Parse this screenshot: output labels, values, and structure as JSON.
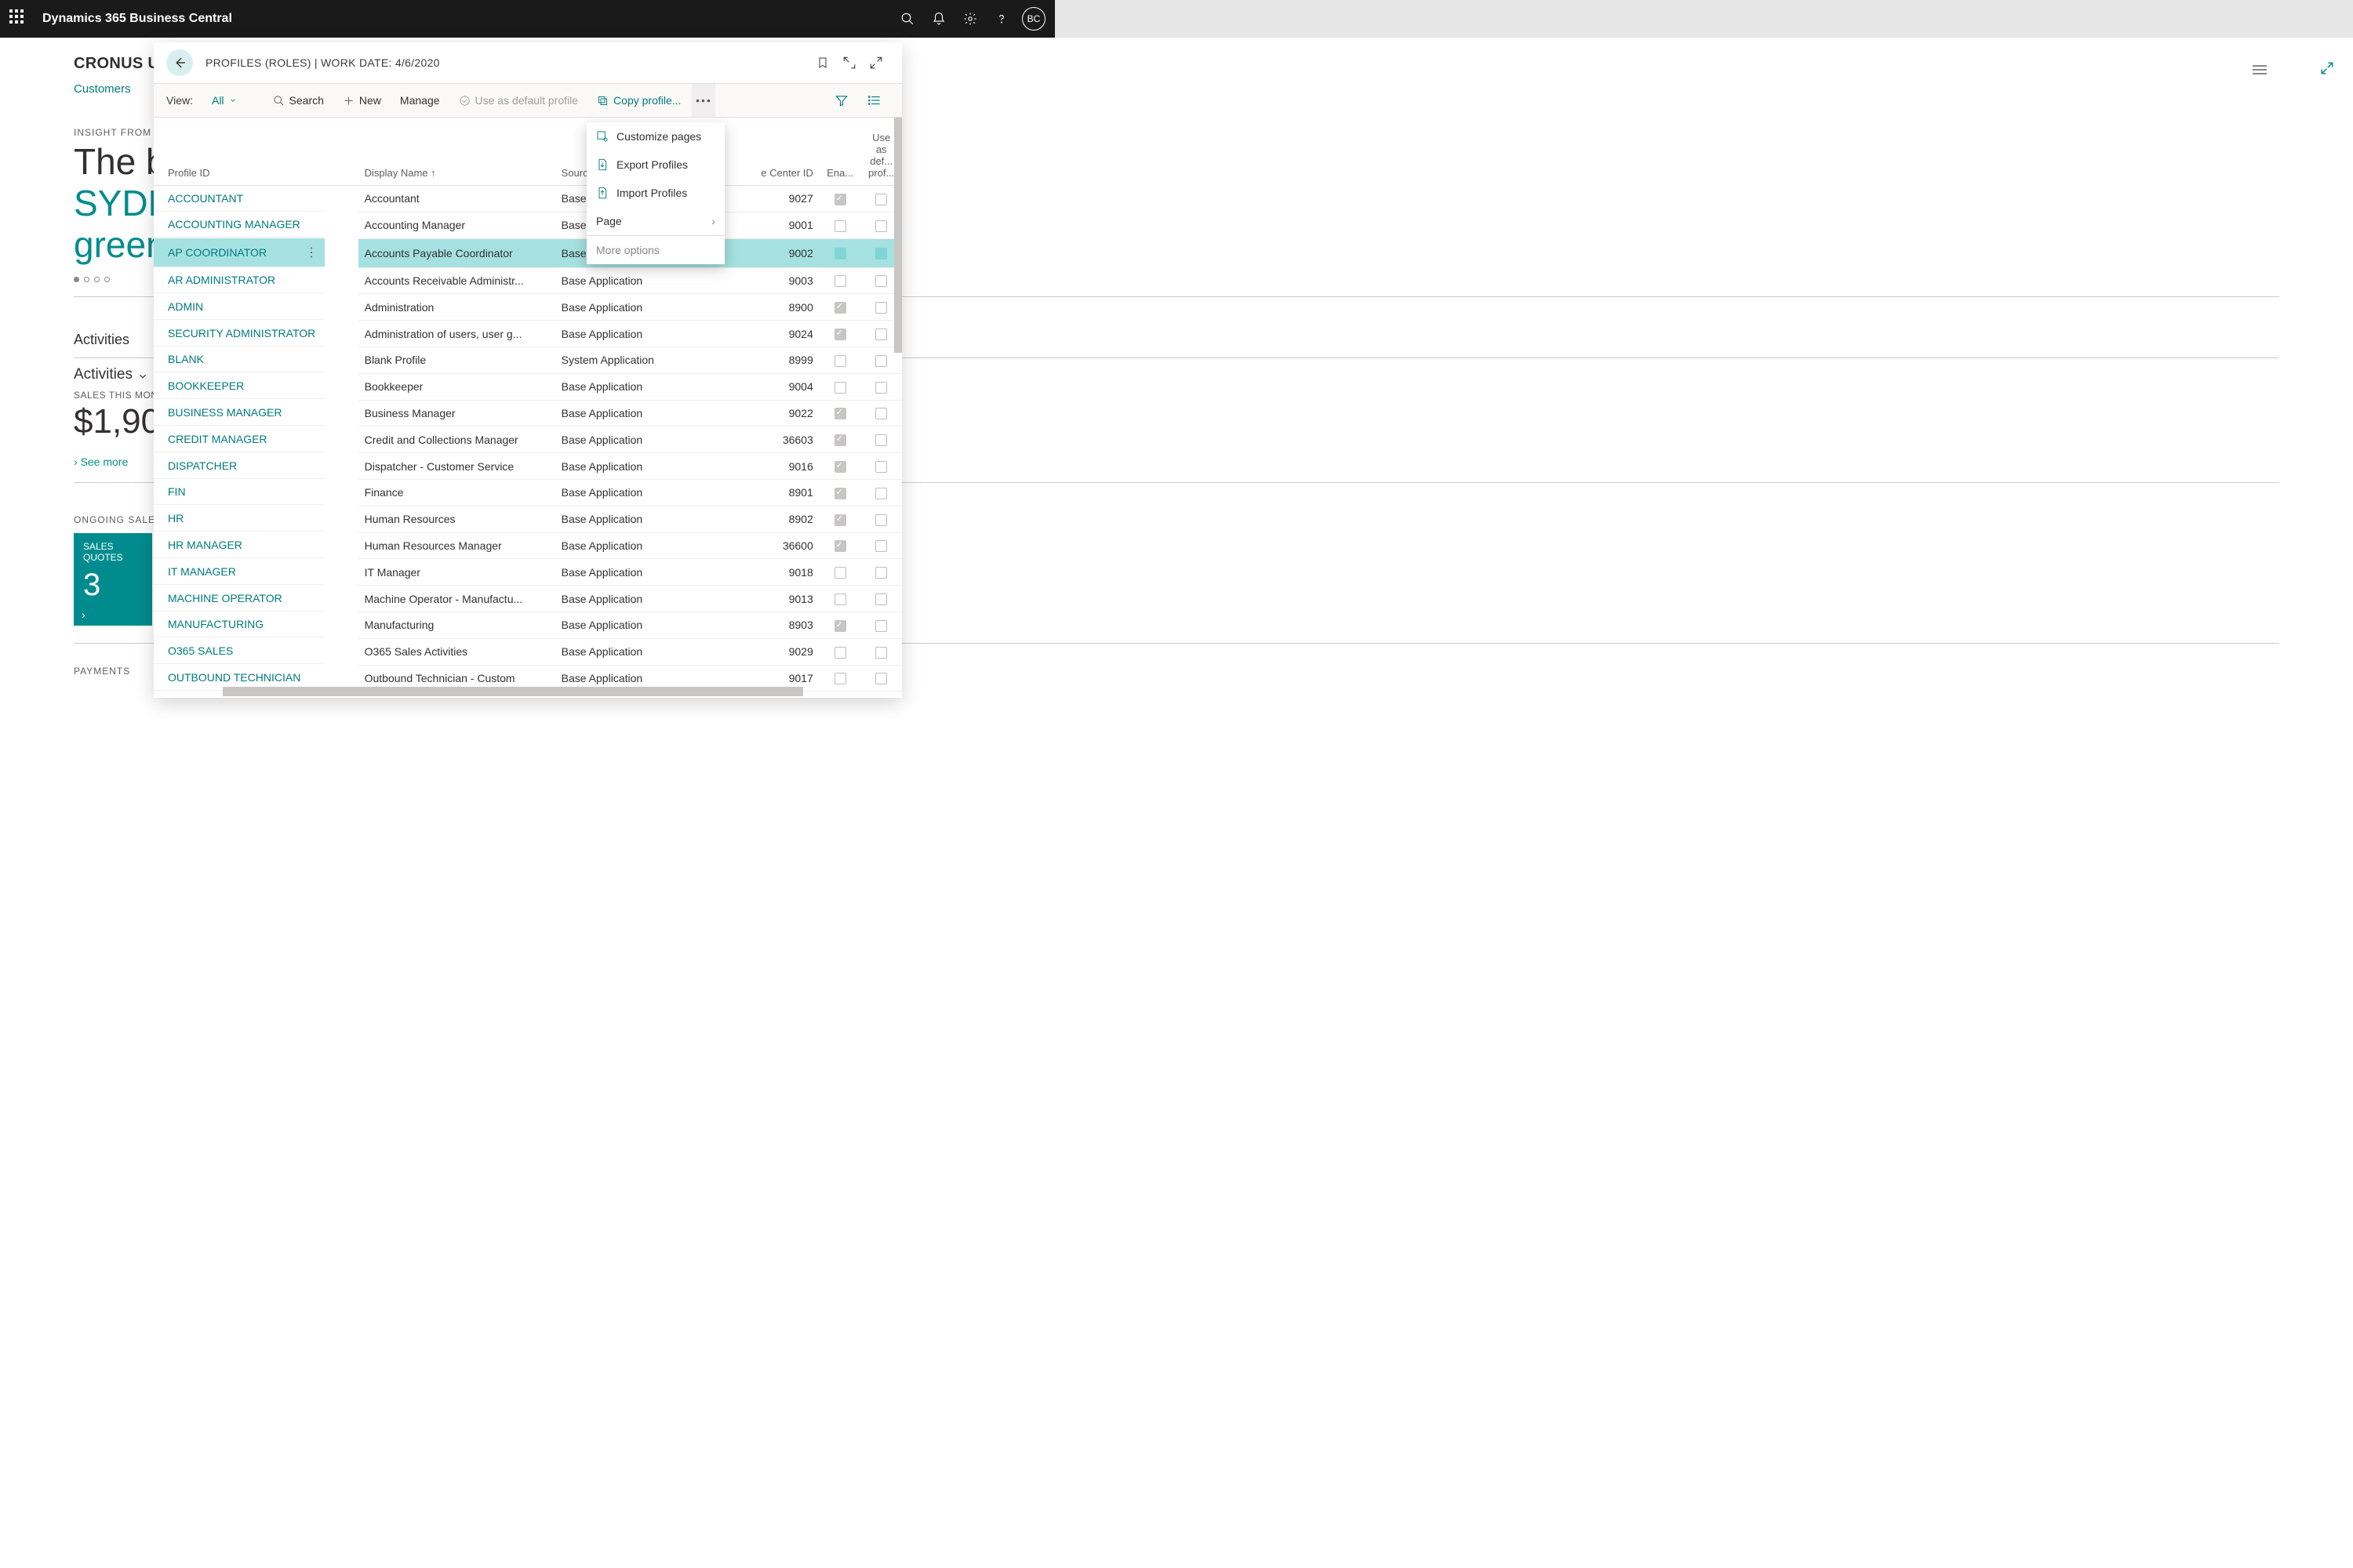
{
  "topbar": {
    "app_title": "Dynamics 365 Business Central",
    "avatar_initials": "BC"
  },
  "role_center": {
    "company": "CRONUS US",
    "tab_customers": "Customers",
    "insight_label": "INSIGHT FROM L",
    "headline_plain1": "The b",
    "headline_teal1": "SYDN",
    "headline_teal2": "green",
    "activities_title": "Activities",
    "activities_collapse": "Activities",
    "sales_month_label": "SALES THIS MON",
    "sales_amount": "$1,90",
    "see_more": "See more",
    "ongoing_label": "ONGOING SALES",
    "tile_sales_quotes": "SALES QUOTES",
    "tile_sales_quotes_num": "3",
    "payments_label": "PAYMENTS"
  },
  "dialog": {
    "title": "PROFILES (ROLES) | WORK DATE: 4/6/2020",
    "view_label": "View:",
    "view_value": "All",
    "cmd_search": "Search",
    "cmd_new": "New",
    "cmd_manage": "Manage",
    "cmd_use_default": "Use as default profile",
    "cmd_copy": "Copy profile..."
  },
  "columns": {
    "profile_id": "Profile ID",
    "display_name": "Display Name",
    "source": "Source",
    "role_center": "e Center ID",
    "enabled": "Ena...",
    "use_as_def": "Use as def... prof..."
  },
  "rows": [
    {
      "id": "ACCOUNTANT",
      "name": "Accountant",
      "source": "Base App",
      "rc": "9027",
      "ena": true,
      "def": false
    },
    {
      "id": "ACCOUNTING MANAGER",
      "name": "Accounting Manager",
      "source": "Base App",
      "rc": "9001",
      "ena": false,
      "def": false
    },
    {
      "id": "AP COORDINATOR",
      "name": "Accounts Payable Coordinator",
      "source": "Base App",
      "rc": "9002",
      "ena": false,
      "def": false,
      "selected": true
    },
    {
      "id": "AR ADMINISTRATOR",
      "name": "Accounts Receivable Administr...",
      "source": "Base Application",
      "rc": "9003",
      "ena": false,
      "def": false
    },
    {
      "id": "ADMIN",
      "name": "Administration",
      "source": "Base Application",
      "rc": "8900",
      "ena": true,
      "def": false
    },
    {
      "id": "SECURITY ADMINISTRATOR",
      "name": "Administration of users, user g...",
      "source": "Base Application",
      "rc": "9024",
      "ena": true,
      "def": false
    },
    {
      "id": "BLANK",
      "name": "Blank Profile",
      "source": "System Application",
      "rc": "8999",
      "ena": false,
      "def": false
    },
    {
      "id": "BOOKKEEPER",
      "name": "Bookkeeper",
      "source": "Base Application",
      "rc": "9004",
      "ena": false,
      "def": false
    },
    {
      "id": "BUSINESS MANAGER",
      "name": "Business Manager",
      "source": "Base Application",
      "rc": "9022",
      "ena": true,
      "def": false
    },
    {
      "id": "CREDIT MANAGER",
      "name": "Credit and Collections Manager",
      "source": "Base Application",
      "rc": "36603",
      "ena": true,
      "def": false
    },
    {
      "id": "DISPATCHER",
      "name": "Dispatcher - Customer Service",
      "source": "Base Application",
      "rc": "9016",
      "ena": true,
      "def": false
    },
    {
      "id": "FIN",
      "name": "Finance",
      "source": "Base Application",
      "rc": "8901",
      "ena": true,
      "def": false
    },
    {
      "id": "HR",
      "name": "Human Resources",
      "source": "Base Application",
      "rc": "8902",
      "ena": true,
      "def": false
    },
    {
      "id": "HR MANAGER",
      "name": "Human Resources Manager",
      "source": "Base Application",
      "rc": "36600",
      "ena": true,
      "def": false
    },
    {
      "id": "IT MANAGER",
      "name": "IT Manager",
      "source": "Base Application",
      "rc": "9018",
      "ena": false,
      "def": false
    },
    {
      "id": "MACHINE OPERATOR",
      "name": "Machine Operator - Manufactu...",
      "source": "Base Application",
      "rc": "9013",
      "ena": false,
      "def": false
    },
    {
      "id": "MANUFACTURING",
      "name": "Manufacturing",
      "source": "Base Application",
      "rc": "8903",
      "ena": true,
      "def": false
    },
    {
      "id": "O365 SALES",
      "name": "O365 Sales Activities",
      "source": "Base Application",
      "rc": "9029",
      "ena": false,
      "def": false
    },
    {
      "id": "OUTBOUND TECHNICIAN",
      "name": "Outbound Technician - Custom",
      "source": "Base Application",
      "rc": "9017",
      "ena": false,
      "def": false
    }
  ],
  "ctx_menu": {
    "customize": "Customize pages",
    "export": "Export Profiles",
    "import": "Import Profiles",
    "page": "Page",
    "more": "More options"
  }
}
